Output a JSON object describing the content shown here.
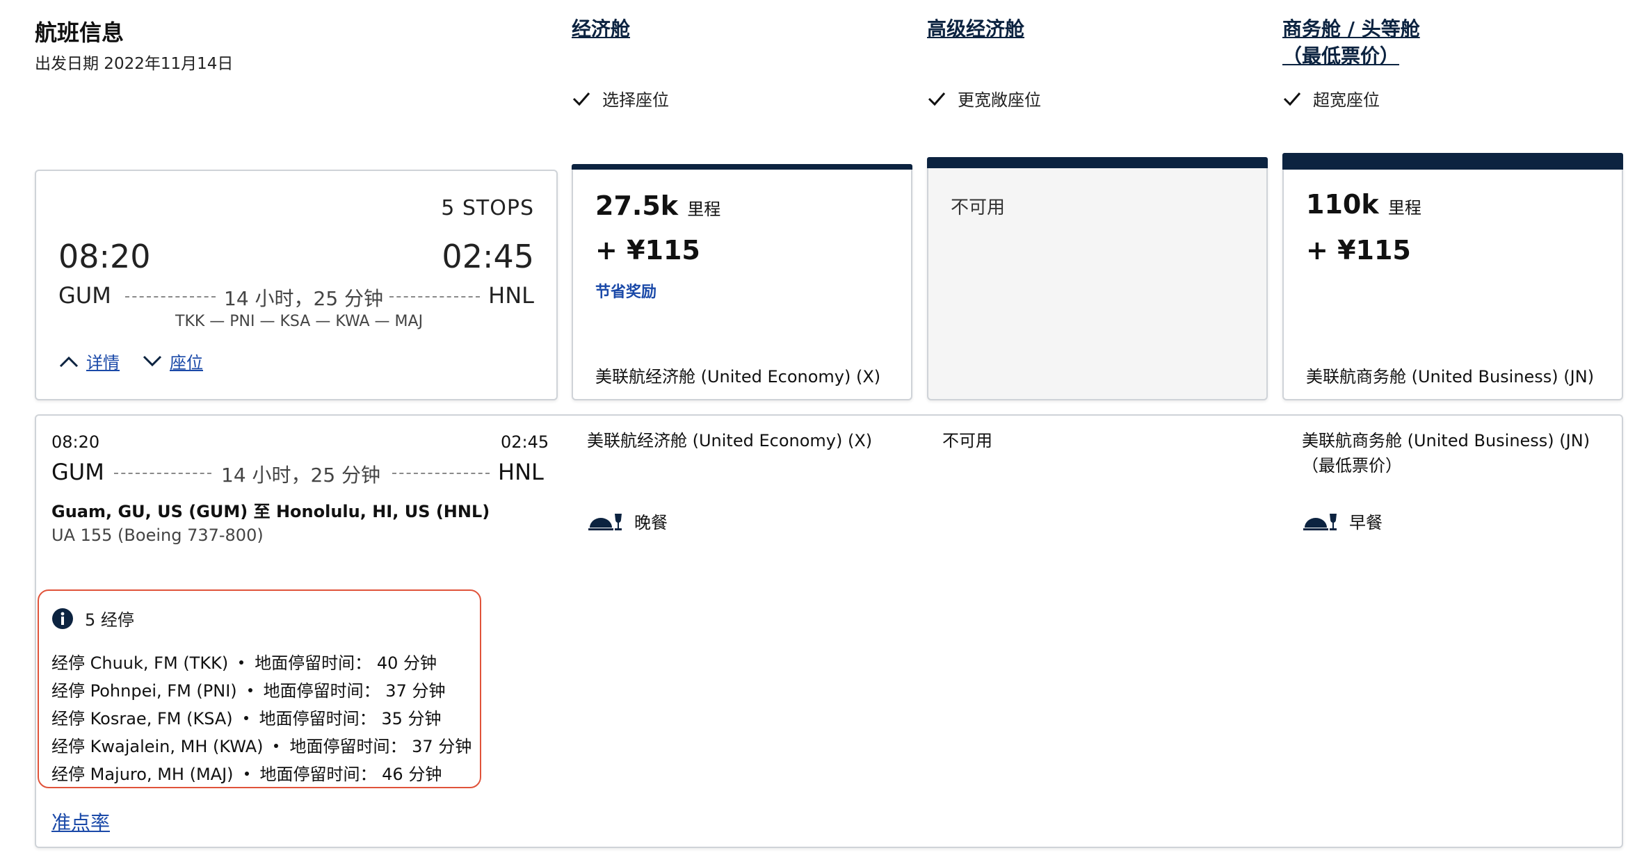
{
  "header": {
    "title": "航班信息",
    "departure_date": "出发日期 2022年11月14日"
  },
  "columns": [
    {
      "title": "经济舱",
      "subtitle": "",
      "feature": "选择座位"
    },
    {
      "title": "高级经济舱",
      "subtitle": "",
      "feature": "更宽敞座位"
    },
    {
      "title": "商务舱 / 头等舱",
      "subtitle": "（最低票价）",
      "feature": "超宽座位"
    }
  ],
  "summary": {
    "stops_label": "5 STOPS",
    "depart_time": "08:20",
    "arrive_time": "02:45",
    "origin": "GUM",
    "destination": "HNL",
    "duration": "14 小时，25 分钟",
    "via": "TKK — PNI — KSA — KWA — MAJ",
    "details_link": "详情",
    "seats_link": "座位"
  },
  "fares": [
    {
      "miles": "27.5k",
      "miles_unit": "里程",
      "price": "+ ¥115",
      "badge": "节省奖励",
      "cabin": "美联航经济舱 (United Economy) (X)"
    },
    {
      "unavailable": "不可用"
    },
    {
      "miles": "110k",
      "miles_unit": "里程",
      "price": "+ ¥115",
      "cabin": "美联航商务舱 (United Business) (JN)"
    }
  ],
  "detail": {
    "depart_time": "08:20",
    "arrive_time": "02:45",
    "origin": "GUM",
    "destination": "HNL",
    "duration": "14 小时，25 分钟",
    "route": "Guam, GU, US (GUM) 至 Honolulu, HI, US (HNL)",
    "flight": "UA 155 (Boeing 737-800)",
    "economy_cabin": "美联航经济舱 (United Economy) (X)",
    "economy_meal": "晚餐",
    "premium_status": "不可用",
    "business_cabin": "美联航商务舱 (United Business) (JN)",
    "business_sub": "（最低票价）",
    "business_meal": "早餐",
    "stops_title": "5 经停",
    "stops": [
      {
        "place": "经停 Chuuk, FM (TKK)",
        "layover_label": "地面停留时间：",
        "layover": "40 分钟"
      },
      {
        "place": "经停 Pohnpei, FM (PNI)",
        "layover_label": "地面停留时间：",
        "layover": "37 分钟"
      },
      {
        "place": "经停 Kosrae, FM (KSA)",
        "layover_label": "地面停留时间：",
        "layover": "35 分钟"
      },
      {
        "place": "经停 Kwajalein, MH (KWA)",
        "layover_label": "地面停留时间：",
        "layover": "37 分钟"
      },
      {
        "place": "经停 Majuro, MH (MAJ)",
        "layover_label": "地面停留时间：",
        "layover": "46 分钟"
      }
    ],
    "ontime_link": "准点率"
  },
  "colors": {
    "navy": "#0c2340",
    "link_blue": "#1a49a8",
    "highlight_red": "#e0533a"
  }
}
